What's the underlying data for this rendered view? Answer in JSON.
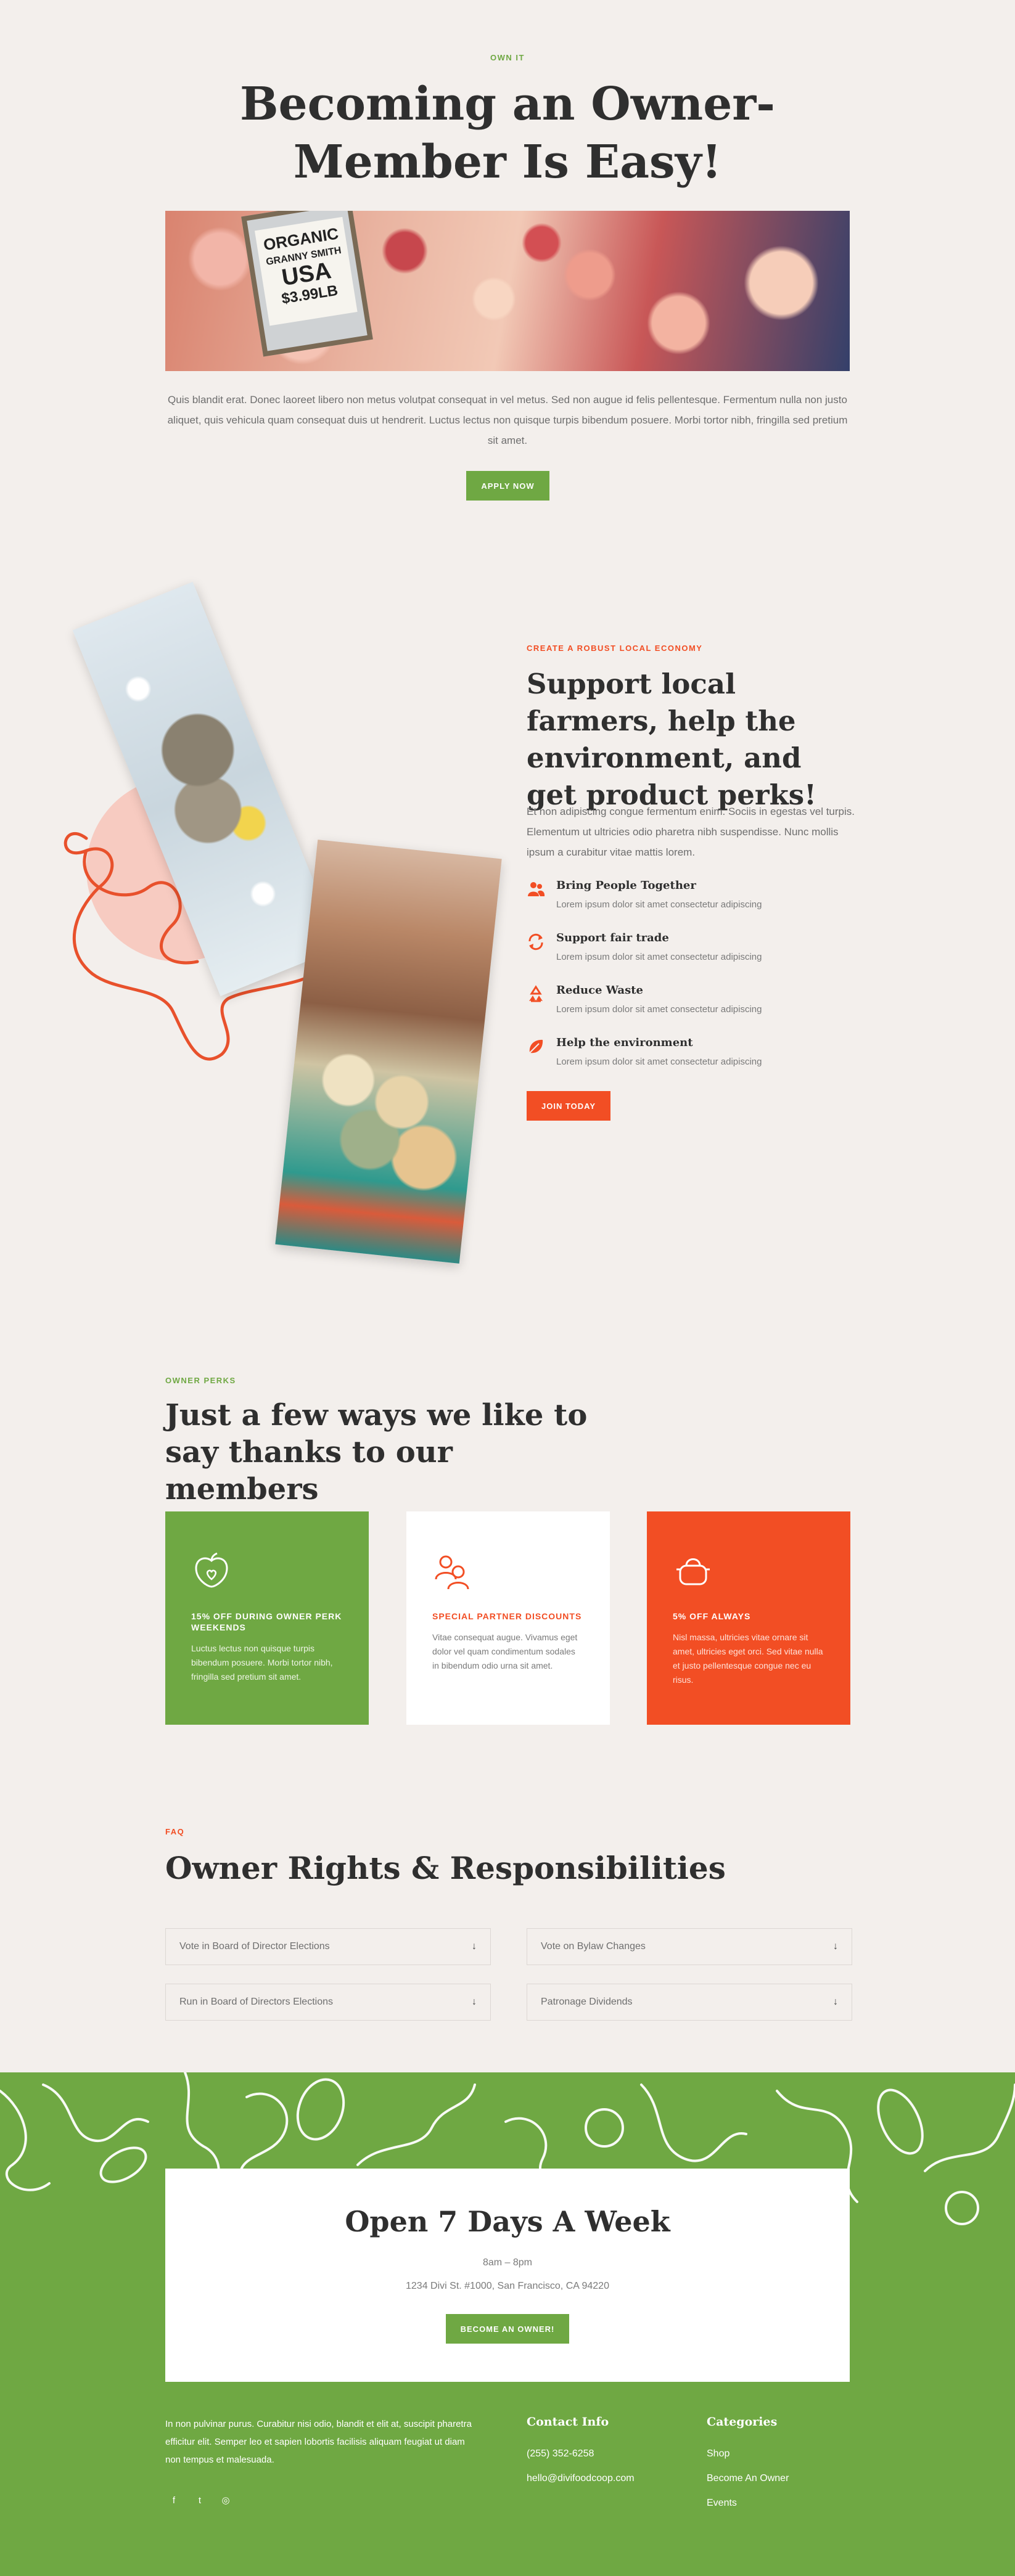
{
  "hero": {
    "eyebrow": "OWN IT",
    "title": "Becoming an Owner-Member Is Easy!",
    "sign": {
      "line1": "ORGANIC",
      "line2": "GRANNY SMITH",
      "line3": "USA",
      "line4": "$3.99LB"
    },
    "body": "Quis blandit erat. Donec laoreet libero non metus volutpat consequat in vel metus. Sed non augue id felis pellentesque. Fermentum nulla non justo aliquet, quis vehicula quam consequat duis ut hendrerit. Luctus lectus non quisque turpis bibendum posuere. Morbi tortor nibh, fringilla sed pretium sit amet.",
    "button": "APPLY NOW"
  },
  "economy": {
    "eyebrow": "CREATE A ROBUST LOCAL ECONOMY",
    "title": "Support local farmers, help the environment, and get product perks!",
    "body": "Et non adipiscing congue fermentum enim. Sociis in egestas vel turpis. Elementum ut ultricies odio pharetra nibh suspendisse. Nunc mollis ipsum a curabitur vitae mattis lorem.",
    "features": [
      {
        "icon": "people-icon",
        "title": "Bring People Together",
        "desc": "Lorem ipsum dolor sit amet consectetur adipiscing"
      },
      {
        "icon": "refresh-icon",
        "title": "Support fair trade",
        "desc": "Lorem ipsum dolor sit amet consectetur adipiscing"
      },
      {
        "icon": "recycle-icon",
        "title": "Reduce Waste",
        "desc": "Lorem ipsum dolor sit amet consectetur adipiscing"
      },
      {
        "icon": "leaf-icon",
        "title": "Help the environment",
        "desc": "Lorem ipsum dolor sit amet consectetur adipiscing"
      }
    ],
    "button": "JOIN TODAY"
  },
  "perks": {
    "eyebrow": "OWNER PERKS",
    "title": "Just a few ways we like to say thanks to our members",
    "cards": [
      {
        "icon": "apple-heart-icon",
        "title": "15% OFF DURING OWNER PERK WEEKENDS",
        "text": "Luctus lectus non quisque turpis bibendum posuere. Morbi tortor nibh, fringilla sed pretium sit amet.",
        "bg": "#6fa843"
      },
      {
        "icon": "partners-icon",
        "title": "SPECIAL PARTNER DISCOUNTS",
        "text": "Vitae consequat augue. Vivamus eget dolor vel quam condimentum sodales in bibendum odio urna sit amet.",
        "bg": "#ffffff"
      },
      {
        "icon": "basket-icon",
        "title": "5% OFF ALWAYS",
        "text": "Nisl massa, ultricies vitae ornare sit amet, ultricies eget orci. Sed vitae nulla et justo pellentesque congue nec eu risus.",
        "bg": "#f24e24"
      }
    ]
  },
  "faq": {
    "eyebrow": "FAQ",
    "title": "Owner Rights & Responsibilities",
    "items": [
      "Vote in Board of Director Elections",
      "Vote on Bylaw Changes",
      "Run in Board of Directors Elections",
      "Patronage Dividends"
    ],
    "arrow": "↓"
  },
  "hours": {
    "title": "Open 7 Days A Week",
    "time": "8am – 8pm",
    "address": "1234 Divi St. #1000, San Francisco, CA 94220",
    "button": "BECOME AN OWNER!"
  },
  "footer": {
    "about": "In non pulvinar purus. Curabitur nisi odio, blandit et elit at, suscipit pharetra efficitur elit. Semper leo et sapien lobortis facilisis aliquam feugiat ut diam non tempus et malesuada.",
    "social": [
      "f",
      "t",
      "◎"
    ],
    "contact_title": "Contact Info",
    "phone": "(255) 352-6258",
    "email": "hello@divifoodcoop.com",
    "categories_title": "Categories",
    "categories": [
      "Shop",
      "Become An Owner",
      "Events"
    ]
  },
  "colors": {
    "green": "#6fa843",
    "red": "#f24e24",
    "background": "#f3efec",
    "dark": "#2f2f2f"
  }
}
